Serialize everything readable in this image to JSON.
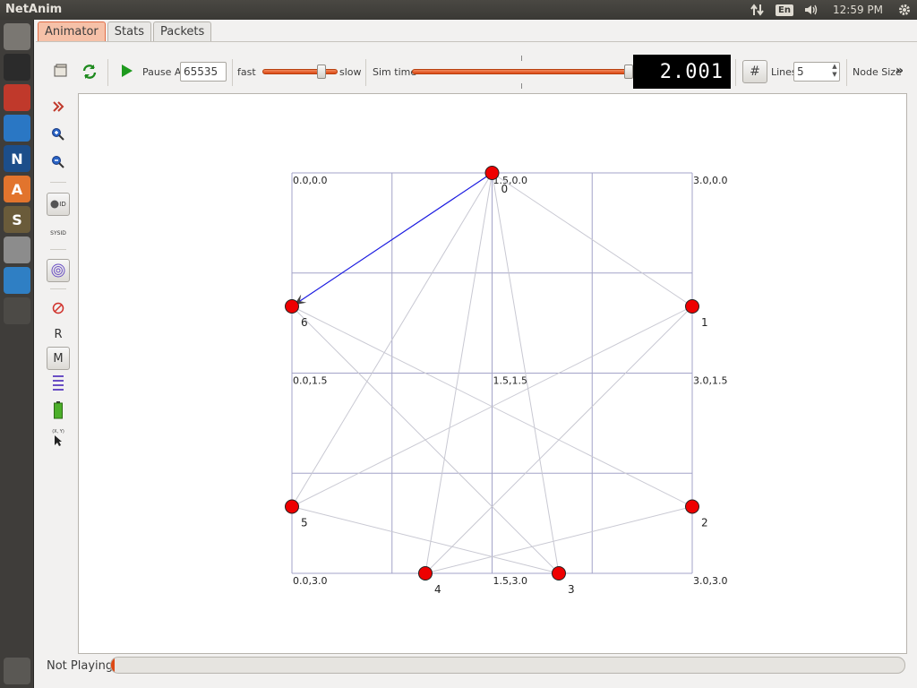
{
  "system": {
    "app_title": "NetAnim",
    "lang": "En",
    "clock": "12:59 PM",
    "icons": [
      "network-icon",
      "volume-icon",
      "settings-gear-icon"
    ]
  },
  "launcher": [
    {
      "name": "dash-home-icon",
      "color": "#7a7772"
    },
    {
      "name": "terminal-icon",
      "color": "#2b2b2b"
    },
    {
      "name": "files-icon",
      "color": "#c0392b"
    },
    {
      "name": "writer-icon",
      "color": "#2a77c4"
    },
    {
      "name": "netanim-icon",
      "color": "#1c4e8a",
      "glyph": "N"
    },
    {
      "name": "software-center-icon",
      "color": "#e2742d",
      "glyph": "A"
    },
    {
      "name": "sublime-icon",
      "color": "#6a5b3a",
      "glyph": "S"
    },
    {
      "name": "system-settings-icon",
      "color": "#8c8c8c"
    },
    {
      "name": "chromium-icon",
      "color": "#2f7fc4"
    },
    {
      "name": "workspace-switcher-icon",
      "color": "#4c4a46"
    },
    {
      "name": "trash-icon",
      "color": "#5a5854"
    }
  ],
  "tabs": [
    {
      "label": "Animator",
      "active": true
    },
    {
      "label": "Stats",
      "active": false
    },
    {
      "label": "Packets",
      "active": false
    }
  ],
  "toolbar": {
    "pause_at_label": "Pause At",
    "pause_at_value": "65535",
    "fast_label": "fast",
    "slow_label": "slow",
    "speed_fraction": 0.78,
    "sim_time_label": "Sim time",
    "sim_time_fraction": 1.0,
    "sim_time_display": "2.001",
    "lines_label": "Lines",
    "lines_value": "5",
    "node_size_label": "Node Size",
    "node_size_more": "»"
  },
  "side_tools": {
    "r_label": "R",
    "m_label": "M",
    "id_label": "ID",
    "sysid_label": "SYSID",
    "xy_label": "(X, Y)"
  },
  "canvas": {
    "grid_labels": [
      {
        "text": "0.0,0.0"
      },
      {
        "text": "1.5,0.0"
      },
      {
        "text": "3.0,0.0"
      },
      {
        "text": "0.0,1.5"
      },
      {
        "text": "1.5,1.5"
      },
      {
        "text": "3.0,1.5"
      },
      {
        "text": "0.0,3.0"
      },
      {
        "text": "1.5,3.0"
      },
      {
        "text": "3.0,3.0"
      }
    ],
    "nodes": [
      {
        "id": "0",
        "x": 1.5,
        "y": 0.0
      },
      {
        "id": "1",
        "x": 3.0,
        "y": 1.0
      },
      {
        "id": "2",
        "x": 3.0,
        "y": 2.5
      },
      {
        "id": "3",
        "x": 2.0,
        "y": 3.0
      },
      {
        "id": "4",
        "x": 1.0,
        "y": 3.0
      },
      {
        "id": "5",
        "x": 0.0,
        "y": 2.5
      },
      {
        "id": "6",
        "x": 0.0,
        "y": 1.0
      }
    ],
    "links": [
      [
        "0",
        "1"
      ],
      [
        "0",
        "3"
      ],
      [
        "0",
        "4"
      ],
      [
        "0",
        "5"
      ],
      [
        "6",
        "2"
      ],
      [
        "6",
        "3"
      ],
      [
        "1",
        "5"
      ],
      [
        "1",
        "4"
      ],
      [
        "2",
        "4"
      ],
      [
        "5",
        "3"
      ]
    ],
    "packet": {
      "from": "0",
      "to": "6",
      "color": "#1a1ae0"
    },
    "node_color": "#ee0000",
    "link_color": "#c8c8d2",
    "grid_color": "#a3a3c8"
  },
  "status": {
    "label": "Not Playing",
    "progress_fraction": 0.005
  }
}
